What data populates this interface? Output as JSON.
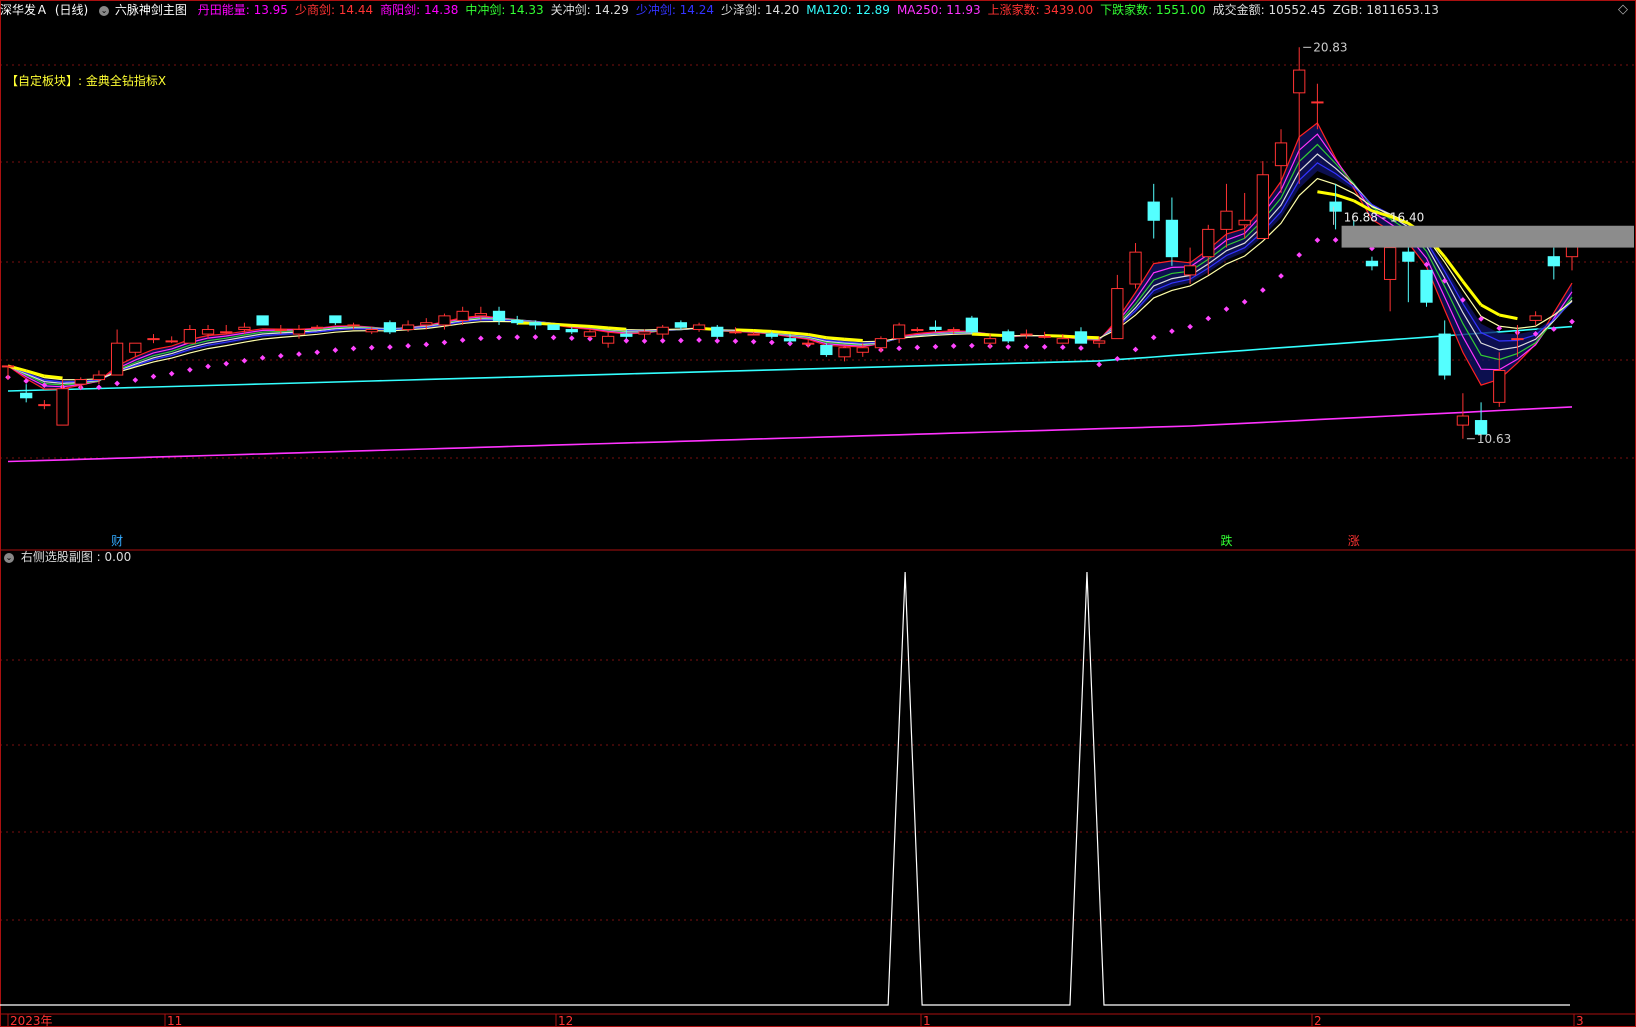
{
  "header": {
    "stock": "深华发Ａ",
    "period": "(日线)",
    "indicator_toggle": "⌄",
    "indicator_name": "六脉神剑主图",
    "items": [
      {
        "label": "丹田能量:",
        "value": "13.95",
        "color": "#ff00ff"
      },
      {
        "label": "少商剑:",
        "value": "14.44",
        "color": "#ff3333"
      },
      {
        "label": "商阳剑:",
        "value": "14.38",
        "color": "#ff00ff"
      },
      {
        "label": "中冲剑:",
        "value": "14.33",
        "color": "#33ff33"
      },
      {
        "label": "关冲剑:",
        "value": "14.29",
        "color": "#dddddd"
      },
      {
        "label": "少冲剑:",
        "value": "14.24",
        "color": "#3333ff"
      },
      {
        "label": "少泽剑:",
        "value": "14.20",
        "color": "#dddddd"
      },
      {
        "label": "MA120:",
        "value": "12.89",
        "color": "#33ffff"
      },
      {
        "label": "MA250:",
        "value": "11.93",
        "color": "#ff33ff"
      },
      {
        "label": "上涨家数:",
        "value": "3439.00",
        "color": "#ff3333"
      },
      {
        "label": "下跌家数:",
        "value": "1551.00",
        "color": "#33ff33"
      },
      {
        "label": "成交金额:",
        "value": "10552.45",
        "color": "#dddddd"
      },
      {
        "label": "ZGB:",
        "value": "1811653.13",
        "color": "#dddddd"
      }
    ]
  },
  "sector_label": "【自定板块】:  金典全钻指标X",
  "sub_panel": {
    "toggle": "⌄",
    "title": "右侧选股副图",
    "value": "0.00"
  },
  "chart_data": {
    "type": "candlestick",
    "ylim": [
      9.8,
      21.4
    ],
    "n_bars": 87,
    "candles": [
      [
        13.8,
        13.8,
        13.5,
        13.8
      ],
      [
        13.2,
        13.4,
        13.0,
        13.1
      ],
      [
        12.95,
        13.05,
        12.85,
        12.95
      ],
      [
        12.5,
        13.5,
        12.5,
        13.3
      ],
      [
        13.4,
        13.55,
        13.3,
        13.5
      ],
      [
        13.5,
        13.7,
        13.4,
        13.6
      ],
      [
        13.6,
        14.6,
        13.6,
        14.3
      ],
      [
        14.1,
        14.3,
        14.0,
        14.3
      ],
      [
        14.4,
        14.5,
        14.3,
        14.4
      ],
      [
        14.35,
        14.45,
        14.3,
        14.35
      ],
      [
        14.3,
        14.7,
        14.3,
        14.6
      ],
      [
        14.5,
        14.7,
        14.4,
        14.6
      ],
      [
        14.55,
        14.7,
        14.5,
        14.55
      ],
      [
        14.6,
        14.75,
        14.5,
        14.65
      ],
      [
        14.9,
        14.9,
        14.7,
        14.7
      ],
      [
        14.6,
        14.7,
        14.5,
        14.6
      ],
      [
        14.5,
        14.7,
        14.4,
        14.6
      ],
      [
        14.65,
        14.7,
        14.6,
        14.65
      ],
      [
        14.9,
        14.9,
        14.7,
        14.75
      ],
      [
        14.7,
        14.75,
        14.6,
        14.7
      ],
      [
        14.55,
        14.65,
        14.5,
        14.6
      ],
      [
        14.75,
        14.8,
        14.5,
        14.55
      ],
      [
        14.6,
        14.8,
        14.55,
        14.7
      ],
      [
        14.7,
        14.85,
        14.6,
        14.75
      ],
      [
        14.7,
        14.95,
        14.6,
        14.9
      ],
      [
        14.8,
        15.1,
        14.7,
        15.0
      ],
      [
        14.9,
        15.1,
        14.8,
        14.95
      ],
      [
        15.0,
        15.1,
        14.7,
        14.8
      ],
      [
        14.8,
        14.9,
        14.7,
        14.75
      ],
      [
        14.75,
        14.8,
        14.6,
        14.7
      ],
      [
        14.7,
        14.7,
        14.6,
        14.6
      ],
      [
        14.6,
        14.65,
        14.5,
        14.55
      ],
      [
        14.45,
        14.6,
        14.4,
        14.55
      ],
      [
        14.3,
        14.55,
        14.2,
        14.45
      ],
      [
        14.5,
        14.6,
        14.4,
        14.45
      ],
      [
        14.5,
        14.6,
        14.4,
        14.55
      ],
      [
        14.5,
        14.7,
        14.4,
        14.65
      ],
      [
        14.75,
        14.8,
        14.6,
        14.65
      ],
      [
        14.6,
        14.75,
        14.55,
        14.7
      ],
      [
        14.65,
        14.7,
        14.4,
        14.45
      ],
      [
        14.55,
        14.65,
        14.5,
        14.55
      ],
      [
        14.5,
        14.55,
        14.5,
        14.5
      ],
      [
        14.5,
        14.55,
        14.4,
        14.45
      ],
      [
        14.4,
        14.5,
        14.3,
        14.35
      ],
      [
        14.3,
        14.4,
        14.2,
        14.3
      ],
      [
        14.25,
        14.3,
        14.0,
        14.05
      ],
      [
        14.0,
        14.25,
        13.9,
        14.2
      ],
      [
        14.1,
        14.3,
        14.0,
        14.2
      ],
      [
        14.2,
        14.45,
        14.1,
        14.4
      ],
      [
        14.4,
        14.75,
        14.3,
        14.7
      ],
      [
        14.6,
        14.65,
        14.55,
        14.6
      ],
      [
        14.65,
        14.8,
        14.55,
        14.6
      ],
      [
        14.6,
        14.65,
        14.5,
        14.6
      ],
      [
        14.85,
        14.9,
        14.5,
        14.55
      ],
      [
        14.3,
        14.5,
        14.2,
        14.4
      ],
      [
        14.55,
        14.6,
        14.3,
        14.35
      ],
      [
        14.5,
        14.6,
        14.4,
        14.5
      ],
      [
        14.45,
        14.55,
        14.4,
        14.45
      ],
      [
        14.3,
        14.5,
        14.3,
        14.4
      ],
      [
        14.55,
        14.65,
        14.3,
        14.3
      ],
      [
        14.3,
        14.45,
        14.2,
        14.35
      ],
      [
        14.4,
        15.8,
        14.4,
        15.5
      ],
      [
        15.6,
        16.5,
        15.5,
        16.3
      ],
      [
        17.4,
        17.8,
        16.6,
        17.0
      ],
      [
        17.0,
        17.5,
        16.0,
        16.2
      ],
      [
        15.8,
        16.4,
        15.6,
        16.0
      ],
      [
        16.2,
        16.9,
        15.8,
        16.8
      ],
      [
        16.8,
        17.8,
        16.4,
        17.2
      ],
      [
        16.9,
        17.6,
        16.6,
        17.0
      ],
      [
        16.6,
        18.3,
        16.6,
        18.0
      ],
      [
        18.2,
        19.0,
        17.6,
        18.7
      ],
      [
        19.8,
        20.8,
        17.8,
        20.3
      ],
      [
        19.6,
        20.0,
        19.0,
        19.6
      ],
      [
        17.4,
        17.8,
        16.8,
        17.2
      ],
      [
        16.8,
        17.0,
        16.5,
        16.7
      ],
      [
        16.1,
        16.2,
        15.9,
        16.0
      ],
      [
        15.7,
        16.6,
        15.0,
        16.4
      ],
      [
        16.3,
        16.7,
        15.2,
        16.1
      ],
      [
        15.9,
        15.9,
        15.1,
        15.2
      ],
      [
        14.5,
        14.8,
        13.5,
        13.6
      ],
      [
        12.5,
        13.2,
        12.2,
        12.7
      ],
      [
        12.6,
        13.0,
        12.2,
        12.3
      ],
      [
        13.0,
        14.1,
        12.9,
        13.7
      ],
      [
        14.4,
        14.7,
        14.0,
        14.4
      ],
      [
        14.8,
        15.0,
        14.7,
        14.9
      ],
      [
        16.2,
        16.4,
        15.7,
        16.0
      ],
      [
        16.2,
        16.8,
        15.9,
        16.6
      ]
    ],
    "price_labels": {
      "high": "20.83",
      "low": "10.63",
      "range": "16.88 - 16.40"
    },
    "markers": [
      {
        "label": "财",
        "color": "#33aaff"
      },
      {
        "label": "跌",
        "color": "#33ff33"
      },
      {
        "label": "涨",
        "color": "#ff3333"
      }
    ],
    "x_tick_labels": [
      "2023年",
      "11",
      "12",
      "1",
      "2",
      "3"
    ],
    "sub_chart": {
      "type": "line",
      "ylim": [
        0,
        1
      ],
      "spikes_at_bars": [
        49,
        59
      ],
      "baseline": 0
    }
  }
}
